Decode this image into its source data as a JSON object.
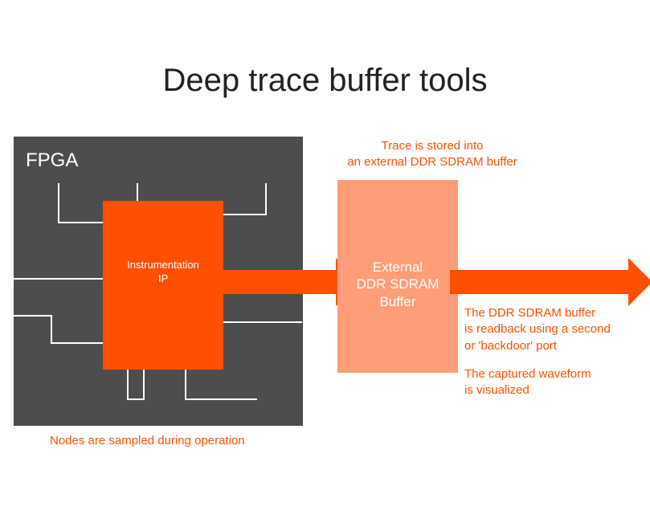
{
  "title": "Deep trace buffer tools",
  "fpga": {
    "label": "FPGA",
    "instrumentation_ip": "Instrumentation\nIP"
  },
  "ddr": {
    "label": "External\nDDR SDRAM\nBuffer"
  },
  "captions": {
    "top": "Trace is stored into\nan external DDR SDRAM buffer",
    "bottom": "Nodes are sampled during operation",
    "right1": "The DDR SDRAM buffer\nis readback using a second\nor 'backdoor' port",
    "right2": "The captured waveform\nis visualized"
  },
  "colors": {
    "accent": "#ff5000",
    "accent_light": "#ff9d78",
    "fpga_bg": "#4d4d4d"
  }
}
